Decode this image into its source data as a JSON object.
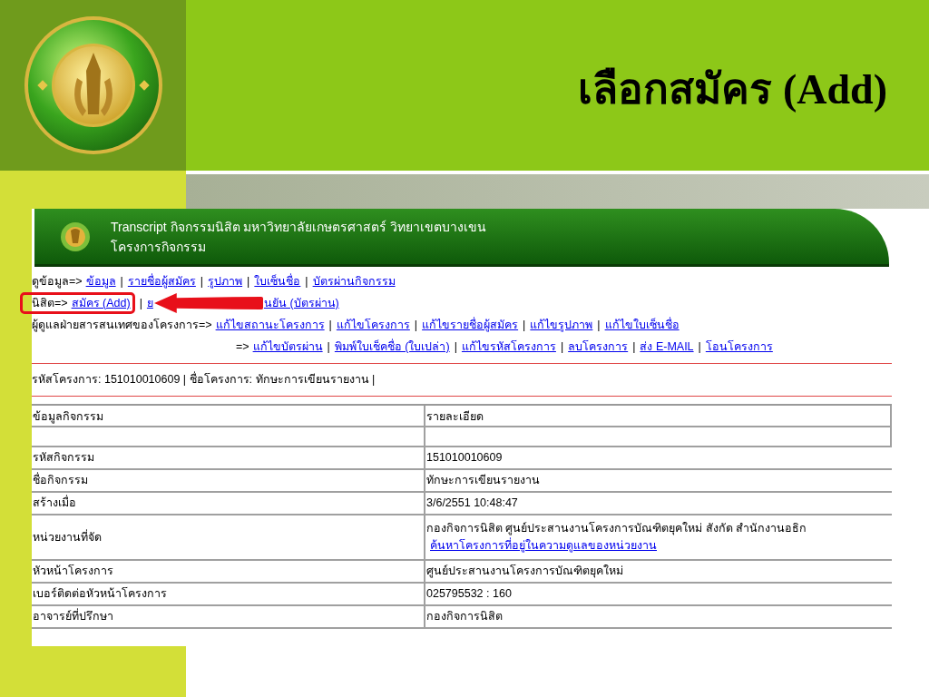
{
  "slide": {
    "title": "เลือกสมัคร (Add)"
  },
  "web_page": {
    "banner": {
      "title": "Transcript กิจกรรมนิสิต มหาวิทยาลัยเกษตรศาสตร์ วิทยาเขตบางเขน",
      "subtitle": "โครงการกิจกรรม"
    },
    "nav_rows": [
      {
        "label": "ดูข้อมูล=>",
        "highlighted": false,
        "indent": false,
        "items": [
          {
            "kind": "link",
            "text": "ข้อมูล"
          },
          {
            "kind": "sep",
            "text": "|"
          },
          {
            "kind": "link",
            "text": "รายชื่อผู้สมัคร"
          },
          {
            "kind": "sep",
            "text": "|"
          },
          {
            "kind": "link",
            "text": "รูปภาพ"
          },
          {
            "kind": "sep",
            "text": "|"
          },
          {
            "kind": "link",
            "text": "ใบเซ็นชื่อ"
          },
          {
            "kind": "sep",
            "text": "|"
          },
          {
            "kind": "link",
            "text": "บัตรผ่านกิจกรรม"
          }
        ]
      },
      {
        "label": "นิสิต=>",
        "highlighted": true,
        "indent": false,
        "items": [
          {
            "kind": "link",
            "text": "สมัคร (Add)"
          },
          {
            "kind": "sep",
            "text": "|"
          },
          {
            "kind": "link",
            "text": "ย"
          },
          {
            "kind": "arrow"
          },
          {
            "kind": "link",
            "text": "นยัน (บัตรผ่าน)"
          }
        ]
      },
      {
        "label": "ผู้ดูแลฝ่ายสารสนเทศของโครงการ=>",
        "highlighted": false,
        "indent": false,
        "items": [
          {
            "kind": "link",
            "text": "แก้ไขสถานะโครงการ"
          },
          {
            "kind": "sep",
            "text": "|"
          },
          {
            "kind": "link",
            "text": "แก้ไขโครงการ"
          },
          {
            "kind": "sep",
            "text": "|"
          },
          {
            "kind": "link",
            "text": "แก้ไขรายชื่อผู้สมัคร"
          },
          {
            "kind": "sep",
            "text": "|"
          },
          {
            "kind": "link",
            "text": "แก้ไขรูปภาพ"
          },
          {
            "kind": "sep",
            "text": "|"
          },
          {
            "kind": "link",
            "text": "แก้ไขใบเซ็นชื่อ"
          }
        ]
      },
      {
        "label": "=>",
        "highlighted": false,
        "indent": true,
        "items": [
          {
            "kind": "link",
            "text": "แก้ไขบัตรผ่าน"
          },
          {
            "kind": "sep",
            "text": "|"
          },
          {
            "kind": "link",
            "text": "พิมพ์ใบเช็คชื่อ (ใบเปล่า)"
          },
          {
            "kind": "sep",
            "text": "|"
          },
          {
            "kind": "link",
            "text": "แก้ไขรหัสโครงการ"
          },
          {
            "kind": "sep",
            "text": "|"
          },
          {
            "kind": "link",
            "text": "ลบโครงการ"
          },
          {
            "kind": "sep",
            "text": "|"
          },
          {
            "kind": "link",
            "text": "ส่ง E-MAIL"
          },
          {
            "kind": "sep",
            "text": "|"
          },
          {
            "kind": "link",
            "text": "โอนโครงการ"
          }
        ]
      }
    ],
    "project_info": "รหัสโครงการ: 151010010609 | ชื่อโครงการ: ทักษะการเขียนรายงาน |",
    "table": {
      "columns": [
        "ข้อมูลกิจกรรม",
        "รายละเอียด"
      ],
      "rows": [
        {
          "kind": "blank"
        },
        {
          "kind": "data",
          "label": "รหัสกิจกรรม",
          "value": "151010010609"
        },
        {
          "kind": "data",
          "label": "ชื่อกิจกรรม",
          "value": "ทักษะการเขียนรายงาน"
        },
        {
          "kind": "data",
          "label": "สร้างเมื่อ",
          "value": "3/6/2551 10:48:47"
        },
        {
          "kind": "data",
          "label": "หน่วยงานที่จัด",
          "value": "กองกิจการนิสิต ศูนย์ประสานงานโครงการบัณฑิตยุคใหม่ สังกัด สำนักงานอธิก",
          "link": "ค้นหาโครงการที่อยู่ในความดูแลของหน่วยงาน"
        },
        {
          "kind": "data",
          "label": "หัวหน้าโครงการ",
          "value": "ศูนย์ประสานงานโครงการบัณฑิตยุคใหม่"
        },
        {
          "kind": "data",
          "label": "เบอร์ติดต่อหัวหน้าโครงการ",
          "value": "025795532 : 160"
        },
        {
          "kind": "data",
          "label": "อาจารย์ที่ปรึกษา",
          "value": "กองกิจการนิสิต"
        }
      ]
    }
  }
}
